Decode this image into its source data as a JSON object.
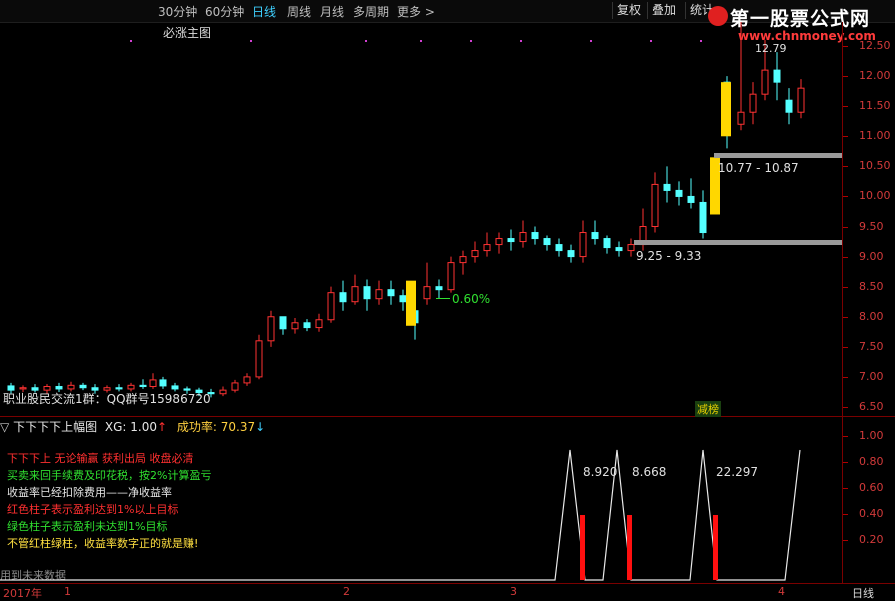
{
  "toolbar": {
    "periods": [
      "30分钟",
      "60分钟",
      "日线",
      "周线",
      "月线",
      "多周期",
      "更多 >"
    ],
    "active": "日线",
    "buttons": [
      "复权",
      "叠加",
      "统计"
    ]
  },
  "brand": {
    "name": "第一股票公式网",
    "url": "www.chnmoney.com"
  },
  "main": {
    "title": "必涨主图",
    "ylim": [
      6.35,
      12.9
    ],
    "y_ticks": [
      "12.50",
      "12.00",
      "11.50",
      "11.00",
      "10.50",
      "10.00",
      "9.50",
      "9.00",
      "8.50",
      "8.00",
      "7.50",
      "7.00",
      "6.50"
    ],
    "annotations": {
      "high_label": "12.79",
      "range_upper": "10.77 - 10.87",
      "range_lower": "9.25 - 9.33",
      "pct_label": "0.60%",
      "footer_text": "职业股民交流1群：QQ群号15986720",
      "badge": "减榜"
    }
  },
  "indicator": {
    "title": "下下下下上幅图",
    "xg_label": "XG: 1.00",
    "success_label": "成功率: 70.37",
    "y_ticks": [
      "1.00",
      "0.80",
      "0.60",
      "0.40",
      "0.20"
    ],
    "values_labels": [
      "8.920",
      "8.668",
      "22.297"
    ],
    "notes": [
      {
        "text": "下下下上 无论输赢 获利出局 收盘必清",
        "color": "#ff3030"
      },
      {
        "text": "买卖来回手续费及印花税，按2%计算盈亏",
        "color": "#30e030"
      },
      {
        "text": "收益率已经扣除费用——净收益率",
        "color": "#e6e6e6"
      },
      {
        "text": "红色柱子表示盈利达到1%以上目标",
        "color": "#ff3030"
      },
      {
        "text": "绿色柱子表示盈利未达到1%目标",
        "color": "#30e030"
      },
      {
        "text": "不管红柱绿柱，收益率数字正的就是赚!",
        "color": "#ffe040"
      }
    ],
    "future_note": "用到未来数据"
  },
  "xaxis": {
    "year": "2017年",
    "months": [
      "1",
      "2",
      "3",
      "4"
    ],
    "period_label": "日线"
  }
}
